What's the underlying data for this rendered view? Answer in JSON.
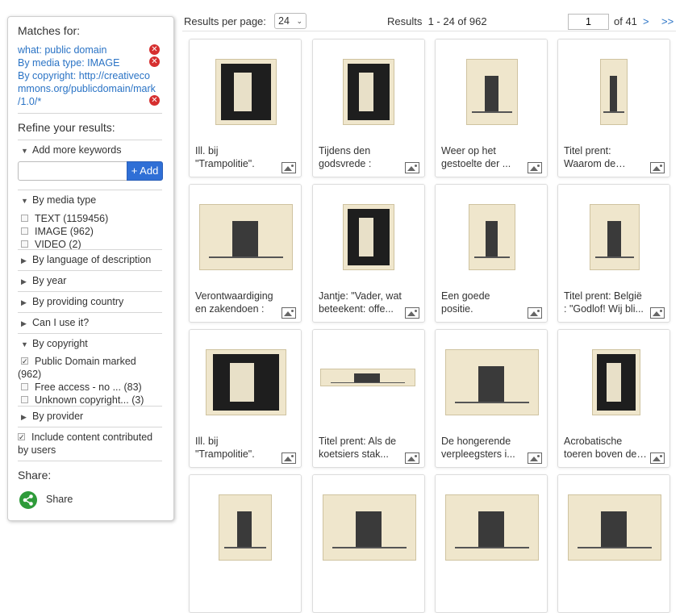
{
  "sidebar": {
    "matches_heading": "Matches for:",
    "matches": [
      {
        "text": "what: public domain"
      },
      {
        "text": "By media type: IMAGE"
      },
      {
        "line1": "By copyright: http://creativeco",
        "line2": "mmons.org/publicdomain/mark",
        "line3": "/1.0/*"
      }
    ],
    "remove_glyph": "✕",
    "refine_heading": "Refine your results:",
    "add_keywords_label": "Add more keywords",
    "keyword_value": "",
    "add_button": "+ Add",
    "media_type_label": "By media type",
    "media_options": [
      {
        "label": "TEXT (1159456)",
        "checked": false
      },
      {
        "label": "IMAGE (962)",
        "checked": false
      },
      {
        "label": "VIDEO (2)",
        "checked": false
      }
    ],
    "language_label": "By language of description",
    "year_label": "By year",
    "country_label": "By providing country",
    "use_label": "Can I use it?",
    "copyright_label": "By copyright",
    "copyright_options": [
      {
        "line1": "Public Domain marked",
        "line2": "(962)",
        "checked": true
      },
      {
        "line1": "Free access - no ... (83)",
        "checked": false
      },
      {
        "line1": "Unknown copyright... (3)",
        "checked": false
      }
    ],
    "provider_label": "By provider",
    "ugc_line1": "Include content contributed",
    "ugc_line2": "by users",
    "ugc_checked": true,
    "share_heading": "Share:",
    "share_label": "Share",
    "share_icon": "share-icon"
  },
  "toolbar": {
    "per_page_label": "Results per page:",
    "per_page_value": "24",
    "results_text": "Results  1 - 24 of 962",
    "page_value": "1",
    "of_pages": "of 41",
    "next": ">",
    "last": ">>"
  },
  "results": [
    {
      "caption": "Ill. bij \"Trampolitie\"."
    },
    {
      "caption": "Tijdens den godsvrede :"
    },
    {
      "caption": "Weer op het gestoelte der ..."
    },
    {
      "caption": "Titel prent: Waarom de vrijzinnige b..."
    },
    {
      "caption": "Verontwaardiging en zakendoen :"
    },
    {
      "caption": "Jantje: \"Vader, wat beteekent: offe..."
    },
    {
      "caption": "Een goede positie."
    },
    {
      "caption": "Titel prent: België : \"Godlof! Wij bli..."
    },
    {
      "caption": "Ill. bij \"Trampolitie\"."
    },
    {
      "caption": "Titel prent: Als de koetsiers stak..."
    },
    {
      "caption": "De hongerende verpleegsters i..."
    },
    {
      "caption": "Acrobatische toeren boven de intern..."
    },
    {
      "caption": ""
    },
    {
      "caption": ""
    },
    {
      "caption": ""
    },
    {
      "caption": ""
    }
  ],
  "colors": {
    "link": "#2a73c5",
    "remove": "#d62f2f",
    "add_button": "#2f6fd6",
    "share": "#2e9b3a"
  }
}
